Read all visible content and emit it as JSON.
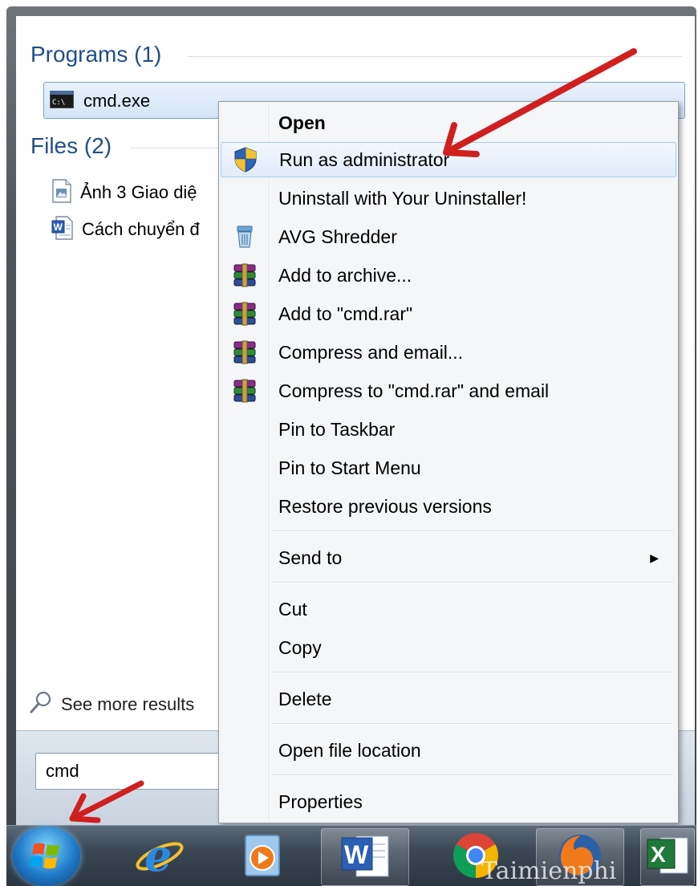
{
  "start_menu": {
    "programs_header": "Programs (1)",
    "program_item": "cmd.exe",
    "files_header": "Files (2)",
    "files": [
      "Ảnh 3 Giao diệ",
      "Cách chuyển đ"
    ],
    "see_more": "See more results",
    "search_value": "cmd"
  },
  "context_menu": {
    "items": [
      "Open",
      "Run as administrator",
      "Uninstall with Your Uninstaller!",
      "AVG Shredder",
      "Add to archive...",
      "Add to \"cmd.rar\"",
      "Compress and email...",
      "Compress to \"cmd.rar\" and email",
      "Pin to Taskbar",
      "Pin to Start Menu",
      "Restore previous versions",
      "Send to",
      "Cut",
      "Copy",
      "Delete",
      "Open file location",
      "Properties"
    ],
    "submenu_arrow": "▶"
  },
  "taskbar": {
    "watermark": "Taimienphi"
  },
  "icons": [
    "uac-shield-icon",
    "avg-shredder-icon",
    "winrar-icon",
    "cmd-icon",
    "image-file-icon",
    "word-file-icon",
    "search-icon",
    "windows-orb-icon",
    "internet-explorer-icon",
    "media-player-icon",
    "word-icon",
    "chrome-icon",
    "firefox-icon",
    "excel-icon"
  ],
  "colors": {
    "header_blue": "#1f4e8c",
    "highlight_border": "#7da2ce",
    "annotation_red": "#d01f1f"
  }
}
